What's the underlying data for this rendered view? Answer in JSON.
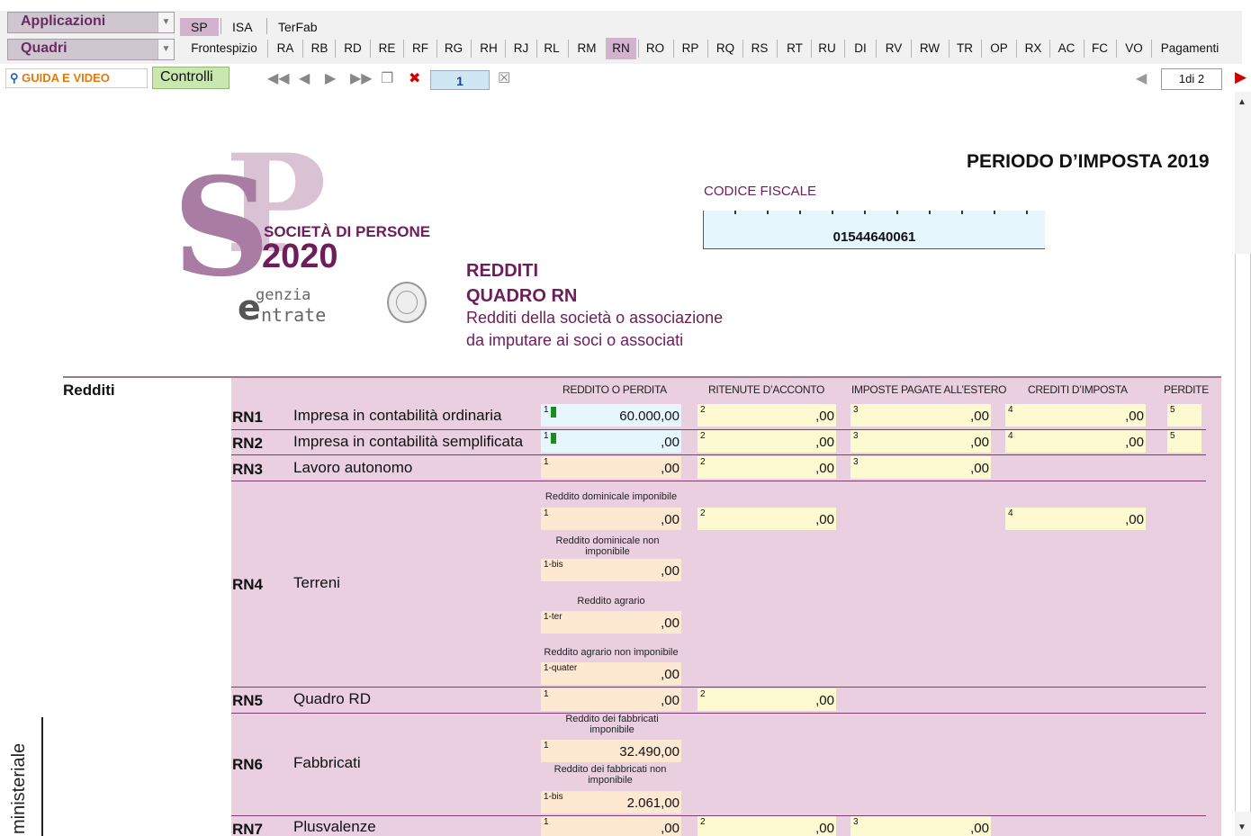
{
  "toolbar": {
    "applicazioni": "Applicazioni",
    "quadri": "Quadri",
    "top_tabs": [
      {
        "label": "SP",
        "selected": true
      },
      {
        "label": "ISA",
        "selected": false
      },
      {
        "label": "TerFab",
        "selected": false
      }
    ],
    "quadri_tabs": [
      {
        "label": "Frontespizio",
        "selected": false
      },
      {
        "label": "RA",
        "selected": false
      },
      {
        "label": "RB",
        "selected": false
      },
      {
        "label": "RD",
        "selected": false
      },
      {
        "label": "RE",
        "selected": false
      },
      {
        "label": "RF",
        "selected": false
      },
      {
        "label": "RG",
        "selected": false
      },
      {
        "label": "RH",
        "selected": false
      },
      {
        "label": "RJ",
        "selected": false
      },
      {
        "label": "RL",
        "selected": false
      },
      {
        "label": "RM",
        "selected": false
      },
      {
        "label": "RN",
        "selected": true
      },
      {
        "label": "RO",
        "selected": false
      },
      {
        "label": "RP",
        "selected": false
      },
      {
        "label": "RQ",
        "selected": false
      },
      {
        "label": "RS",
        "selected": false
      },
      {
        "label": "RT",
        "selected": false
      },
      {
        "label": "RU",
        "selected": false
      },
      {
        "label": "DI",
        "selected": false
      },
      {
        "label": "RV",
        "selected": false
      },
      {
        "label": "RW",
        "selected": false
      },
      {
        "label": "TR",
        "selected": false
      },
      {
        "label": "OP",
        "selected": false
      },
      {
        "label": "RX",
        "selected": false
      },
      {
        "label": "AC",
        "selected": false
      },
      {
        "label": "FC",
        "selected": false
      },
      {
        "label": "VO",
        "selected": false
      },
      {
        "label": "Pagamenti",
        "selected": false
      }
    ],
    "guida": "GUIDA E VIDEO",
    "controlli": "Controlli",
    "page_value": "1",
    "pager": "1di 2",
    "selected_color": "#d2b3cd"
  },
  "header": {
    "logo_soc": "SOCIETÀ DI PERSONE",
    "logo_year": "2020",
    "logo_agenzia": "genzia",
    "logo_entrate": "ntrate",
    "logo_e": "e",
    "redditi": "REDDITI",
    "quadro": "QUADRO RN",
    "subtitle1": "Redditi della società o associazione",
    "subtitle2": "da imputare ai soci o associati",
    "periodo": "PERIODO D’IMPOSTA 2019",
    "cf_label": "CODICE FISCALE",
    "cf_value": "01544640061"
  },
  "form": {
    "section": "Redditi",
    "columns": [
      "REDDITO O PERDITA",
      "RITENUTE D’ACCONTO",
      "IMPOSTE PAGATE ALL’ESTERO",
      "CREDITI D’IMPOSTA",
      "PERDITE"
    ],
    "rows": {
      "rn1": {
        "code": "RN1",
        "desc": "Impresa in contabilità ordinaria",
        "f1": "60.000,00",
        "f2": ",00",
        "f3": ",00",
        "f4": ",00"
      },
      "rn2": {
        "code": "RN2",
        "desc": "Impresa in contabilità semplificata",
        "f1": ",00",
        "f2": ",00",
        "f3": ",00",
        "f4": ",00"
      },
      "rn3": {
        "code": "RN3",
        "desc": "Lavoro autonomo",
        "f1": ",00",
        "f2": ",00",
        "f3": ",00"
      },
      "rn4": {
        "code": "RN4",
        "desc": "Terreni",
        "lab1": "Reddito dominicale imponibile",
        "f1": ",00",
        "f2": ",00",
        "f4": ",00",
        "lab1bis": "Reddito dominicale non imponibile",
        "f1bis": ",00",
        "lab1ter": "Reddito agrario",
        "f1ter": ",00",
        "lab1quater": "Reddito agrario non imponibile",
        "f1quater": ",00"
      },
      "rn5": {
        "code": "RN5",
        "desc": "Quadro RD",
        "f1": ",00",
        "f2": ",00"
      },
      "rn6": {
        "code": "RN6",
        "desc": "Fabbricati",
        "lab1": "Reddito dei fabbricati imponibile",
        "f1": "32.490,00",
        "lab1bis": "Reddito dei fabbricati non imponibile",
        "f1bis": "2.061,00"
      },
      "rn7": {
        "code": "RN7",
        "desc": "Plusvalenze",
        "f1": ",00",
        "f2": ",00",
        "f3": ",00"
      }
    },
    "nums": {
      "n1": "1",
      "n2": "2",
      "n3": "3",
      "n4": "4",
      "n5": "5",
      "n1bis": "1-bis",
      "n1ter": "1-ter",
      "n1quater": "1-quater"
    }
  },
  "side": {
    "ministeriale": "ministeriale"
  }
}
